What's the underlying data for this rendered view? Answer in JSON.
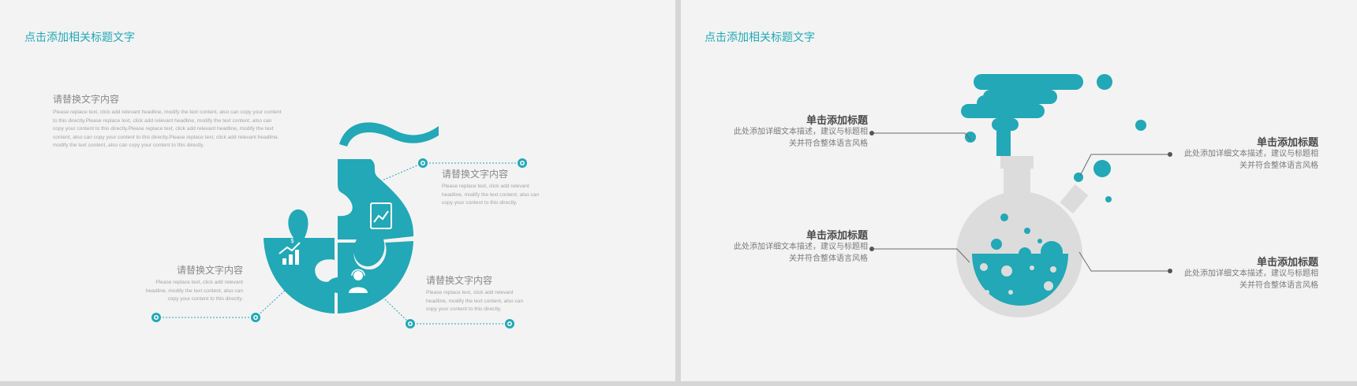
{
  "colors": {
    "accent": "#22a8b6",
    "flask_glass": "#dcdcdc",
    "line": "#555555"
  },
  "left_slide": {
    "title": "点击添加相关标题文字",
    "icons": [
      "chart-growth-icon",
      "tablet-chart-icon",
      "user-support-icon"
    ],
    "block_top_left": {
      "heading": "请替换文字内容",
      "body": "Please replace text, click add relevant headline, modify the text content, also can copy your content to this directly.Please replace text, click add relevant headline, modify the text content, also can copy your content to this directly.Please replace text, click add relevant headline, modify the text content, also can copy your content to this directly.Please replace text, click add relevant headline, modify the text content, also can copy your content to this directly."
    },
    "block_top_right": {
      "heading": "请替换文字内容",
      "body": "Please replace text, click add relevant headline, modify the text content, also can copy your content to this directly."
    },
    "block_bottom_left": {
      "heading": "请替换文字内容",
      "body": "Please replace text, click add relevant headline, modify the text content, also can copy your content to this directly."
    },
    "block_bottom_right": {
      "heading": "请替换文字内容",
      "body": "Please replace text, click add relevant headline, modify the text content, also can copy your content to this directly."
    }
  },
  "right_slide": {
    "title": "点击添加相关标题文字",
    "callouts": [
      {
        "title": "单击添加标题",
        "desc": "此处添加详细文本描述，建议与标题相关并符合整体语言风格"
      },
      {
        "title": "单击添加标题",
        "desc": "此处添加详细文本描述，建议与标题相关并符合整体语言风格"
      },
      {
        "title": "单击添加标题",
        "desc": "此处添加详细文本描述，建议与标题相关并符合整体语言风格"
      },
      {
        "title": "单击添加标题",
        "desc": "此处添加详细文本描述，建议与标题相关并符合整体语言风格"
      }
    ]
  }
}
